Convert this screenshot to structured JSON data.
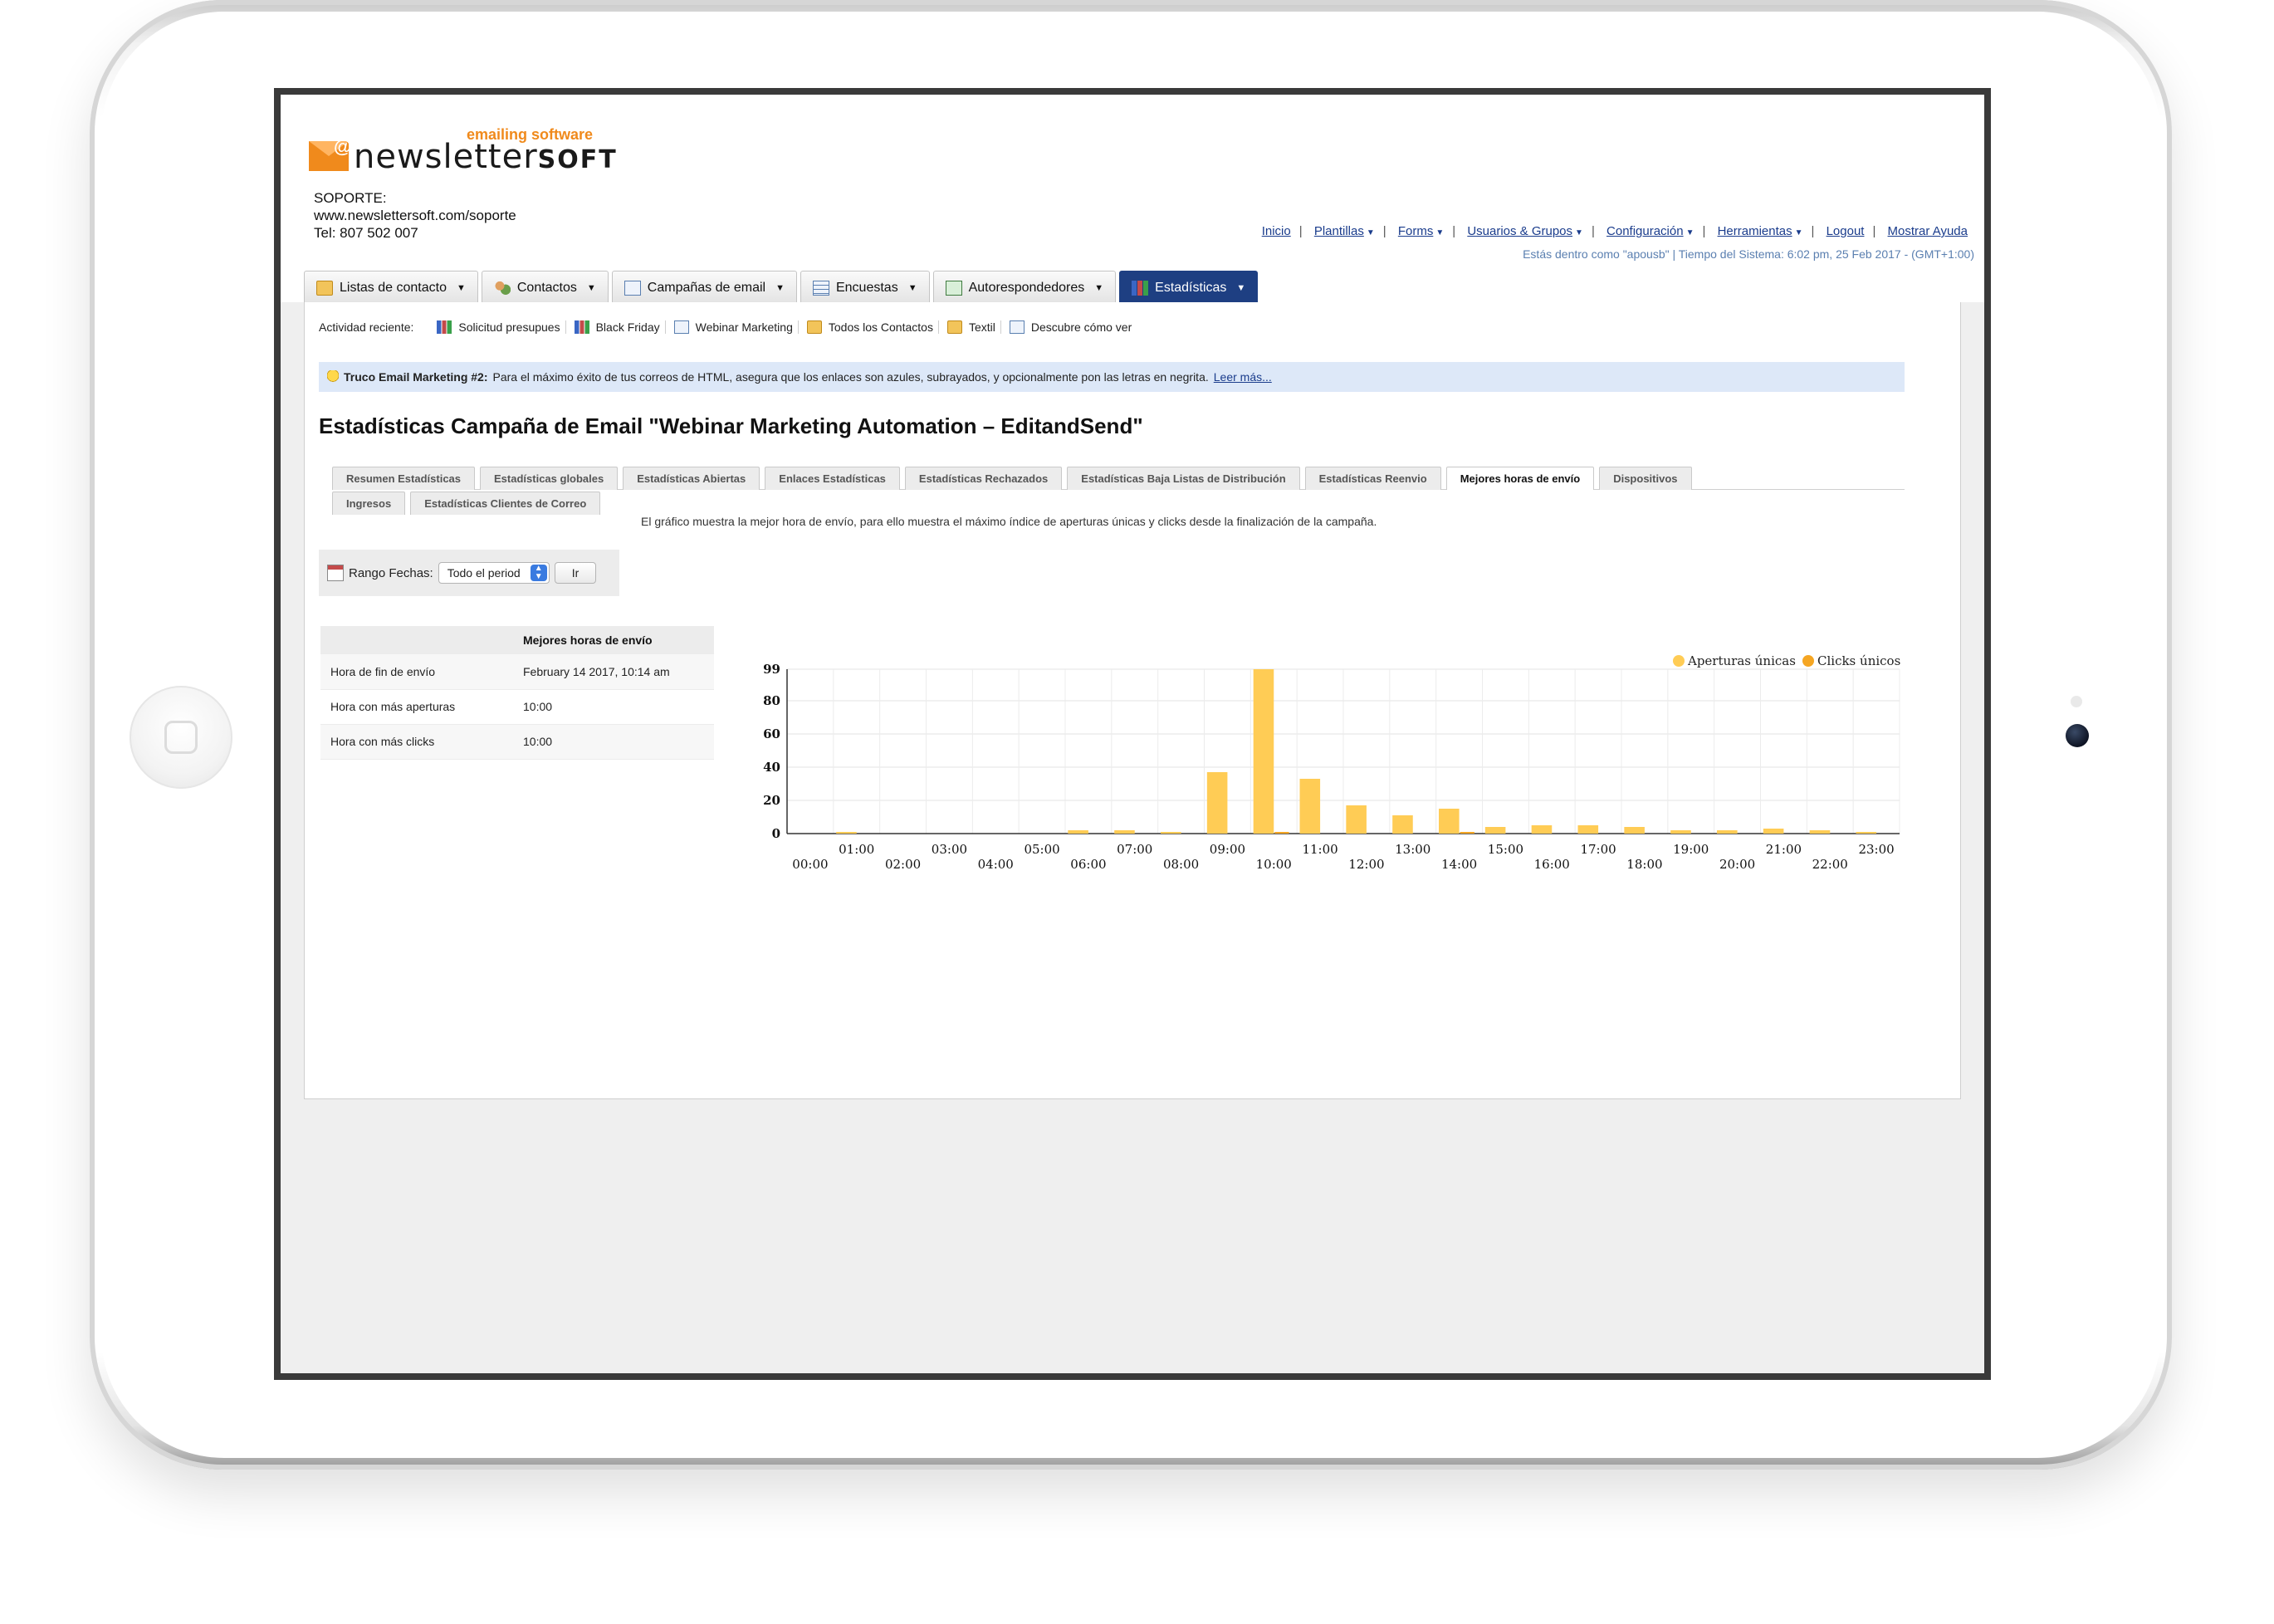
{
  "header": {
    "logo_tagline": "emailing software",
    "logo_word": "newsletter",
    "logo_word_suffix": "SOFT",
    "support_label": "SOPORTE:",
    "support_url": "www.newslettersoft.com/soporte",
    "support_tel": "Tel: 807 502 007",
    "links": [
      "Inicio",
      "Plantillas",
      "Forms",
      "Usuarios & Grupos",
      "Configuración",
      "Herramientas",
      "Logout",
      "Mostrar Ayuda"
    ],
    "logged_in": "Estás dentro como \"apousb\" | Tiempo del Sistema: 6:02 pm, 25 Feb 2017 - (GMT+1:00)"
  },
  "main_tabs": [
    {
      "label": "Listas de contacto",
      "icon": "folder-icon"
    },
    {
      "label": "Contactos",
      "icon": "people-icon"
    },
    {
      "label": "Campañas de email",
      "icon": "mail-icon"
    },
    {
      "label": "Encuestas",
      "icon": "poll-icon"
    },
    {
      "label": "Autorespondedores",
      "icon": "autoresponder-icon"
    },
    {
      "label": "Estadísticas",
      "icon": "bar-chart-icon",
      "active": true
    }
  ],
  "recent": {
    "label": "Actividad reciente:",
    "items": [
      {
        "label": "Solicitud presupues",
        "icon": "bar-chart-icon"
      },
      {
        "label": "Black Friday",
        "icon": "bar-chart-icon"
      },
      {
        "label": "Webinar Marketing",
        "icon": "mail-icon"
      },
      {
        "label": "Todos los Contactos",
        "icon": "folder-icon"
      },
      {
        "label": "Textil",
        "icon": "folder-icon"
      },
      {
        "label": "Descubre cómo ver",
        "icon": "mail-icon"
      }
    ]
  },
  "tip": {
    "title": "Truco Email Marketing #2:",
    "text": "Para el máximo éxito de tus correos de HTML, asegura que los enlaces son azules, subrayados, y opcionalmente pon las letras en negrita.",
    "link": "Leer más..."
  },
  "page_title": "Estadísticas Campaña de Email \"Webinar Marketing Automation – EditandSend\"",
  "stat_tabs_row1": [
    "Resumen Estadísticas",
    "Estadísticas globales",
    "Estadísticas Abiertas",
    "Enlaces Estadísticas",
    "Estadísticas Rechazados",
    "Estadísticas Baja Listas de Distribución",
    "Estadísticas Reenvio",
    "Mejores horas de envío",
    "Dispositivos"
  ],
  "stat_tabs_row2": [
    "Ingresos",
    "Estadísticas Clientes de Correo"
  ],
  "active_stat_tab": "Mejores horas de envío",
  "description": "El gráfico muestra la mejor hora de envío, para ello muestra el máximo índice de aperturas únicas y clicks desde la finalización de la campaña.",
  "range": {
    "label": "Rango Fechas:",
    "selected": "Todo el period",
    "button": "Ir"
  },
  "summary": {
    "header": "Mejores horas de envío",
    "rows": [
      {
        "label": "Hora de fin de envío",
        "value": "February 14 2017, 10:14 am"
      },
      {
        "label": "Hora con más aperturas",
        "value": "10:00"
      },
      {
        "label": "Hora con más clicks",
        "value": "10:00"
      }
    ]
  },
  "colors": {
    "brand_blue": "#1e3f82",
    "opens": "#ffcc55",
    "clicks": "#f5a623"
  },
  "chart_data": {
    "type": "bar",
    "categories": [
      "00:00",
      "01:00",
      "02:00",
      "03:00",
      "04:00",
      "05:00",
      "06:00",
      "07:00",
      "08:00",
      "09:00",
      "10:00",
      "11:00",
      "12:00",
      "13:00",
      "14:00",
      "15:00",
      "16:00",
      "17:00",
      "18:00",
      "19:00",
      "20:00",
      "21:00",
      "22:00",
      "23:00"
    ],
    "series": [
      {
        "name": "Aperturas únicas",
        "values": [
          0,
          1,
          0,
          0,
          0,
          0,
          2,
          2,
          1,
          37,
          99,
          33,
          17,
          11,
          15,
          4,
          5,
          5,
          4,
          2,
          2,
          3,
          2,
          1
        ]
      },
      {
        "name": "Clicks únicos",
        "values": [
          0,
          0,
          0,
          0,
          0,
          0,
          0,
          0,
          0,
          0,
          1,
          0,
          0,
          0,
          1,
          0,
          0,
          0,
          0,
          0,
          0,
          0,
          0,
          0
        ]
      }
    ],
    "yticks": [
      0,
      20,
      40,
      60,
      80,
      99
    ],
    "ylim": [
      0,
      99
    ],
    "grid": true,
    "legend": "top-right"
  }
}
